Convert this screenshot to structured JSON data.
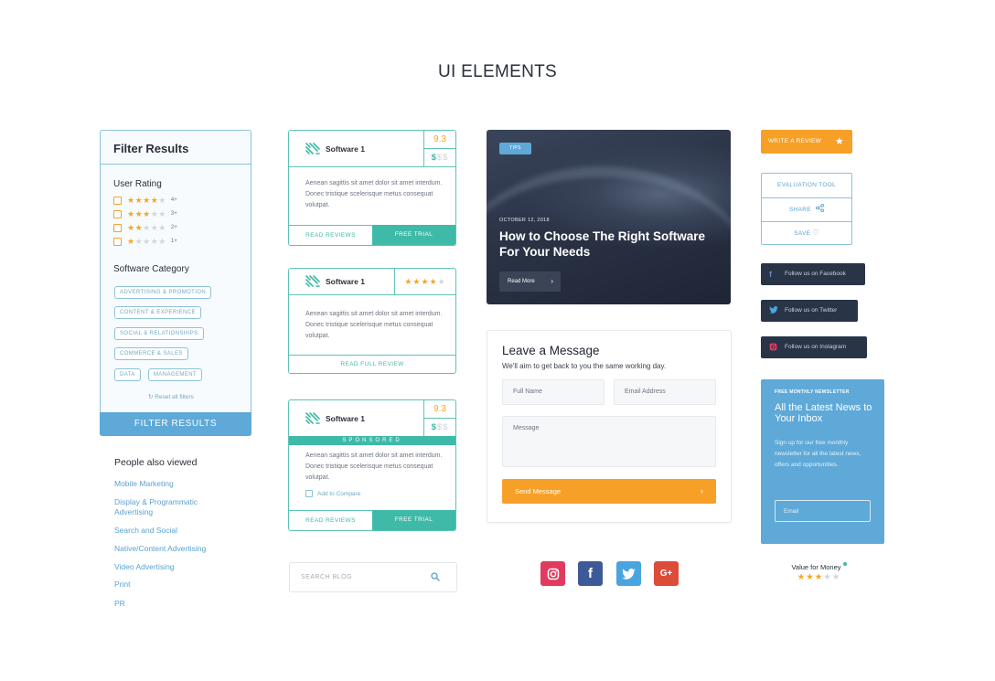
{
  "page": {
    "title": "UI ELEMENTS"
  },
  "filter": {
    "title": "Filter Results",
    "user_rating_label": "User Rating",
    "ratings": [
      {
        "stars": 4,
        "label": "4+"
      },
      {
        "stars": 3,
        "label": "3+"
      },
      {
        "stars": 2,
        "label": "2+"
      },
      {
        "stars": 1,
        "label": "1+"
      }
    ],
    "category_label": "Software Category",
    "categories": [
      "ADVERTISING & PROMOTION",
      "CONTENT & EXPERIENCE",
      "SOCIAL & RELATIONSHIPS",
      "COMMERCE & SALES",
      "DATA",
      "MANAGEMENT"
    ],
    "reset_label": "Reset all filters",
    "button_label": "FILTER RESULTS"
  },
  "people_also_viewed": {
    "title": "People also viewed",
    "links": [
      "Mobile Marketing",
      "Display & Programmatic Advertising",
      "Search and Social",
      "Native/Content Advertising",
      "Video Advertising",
      "Print",
      "PR"
    ]
  },
  "cards": [
    {
      "name": "Software 1",
      "score": "9.3",
      "price_active": "$",
      "price_inactive": "$$",
      "body": "Aenean sagittis sit amet dolor sit amet interdum. Donec tristique scelerisque metus consequat volutpat.",
      "btn_left": "READ REVIEWS",
      "btn_right": "FREE TRIAL"
    },
    {
      "name": "Software 1",
      "stars": 4,
      "body": "Aenean sagittis sit amet dolor sit amet interdum. Donec tristique scelerisque metus consequat volutpat.",
      "btn_full": "READ FULL REVIEW"
    },
    {
      "name": "Software 1",
      "score": "9.3",
      "price_active": "$",
      "price_inactive": "$$",
      "sponsored": "SPONSORED",
      "body": "Aenean sagittis sit amet dolor sit amet interdum. Donec tristique scelerisque metus consequat volutpat.",
      "compare_label": "Add to Compare",
      "btn_left": "READ REVIEWS",
      "btn_right": "FREE TRIAL"
    }
  ],
  "search": {
    "placeholder": "SEARCH BLOG"
  },
  "hero": {
    "tag": "TIPS",
    "date": "OCTOBER 12, 2018",
    "title": "How to Choose The Right Software For Your Needs",
    "button": "Read More"
  },
  "message": {
    "title": "Leave a Message",
    "subtitle": "We'll aim to get back to you the same working day.",
    "full_name": "Full Name",
    "email": "Email Address",
    "message": "Message",
    "button": "Send Message"
  },
  "social_icons": [
    "instagram-icon",
    "facebook-icon",
    "twitter-icon",
    "google-plus-icon"
  ],
  "actions": {
    "write_review": "WRITE A REVIEW",
    "evaluation_tool": "EVALUATION TOOL",
    "share": "SHARE",
    "save": "SAVE"
  },
  "follow": {
    "facebook": "Follow us on Facebook",
    "twitter": "Follow us on Twitter",
    "instagram": "Follow us on Instagram"
  },
  "newsletter": {
    "kicker": "FREE MONTHLY NEWSLETTER",
    "title": "All the Latest News to Your Inbox",
    "description": "Sign up for our free monthly newsletter for all the latest news, offers and opportunities.",
    "email_placeholder": "Email"
  },
  "value_for_money": {
    "label": "Value for Money",
    "stars": 3
  },
  "colors": {
    "teal": "#3fb9a8",
    "blue": "#5ea9d8",
    "orange": "#f6a028",
    "navy": "#2a3447",
    "star": "#f5a623"
  }
}
